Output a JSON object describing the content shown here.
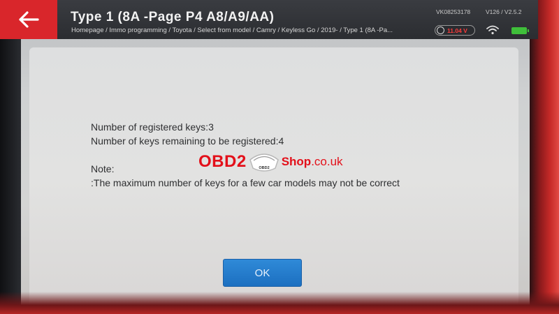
{
  "header": {
    "back_icon": "back-arrow-icon",
    "title": "Type 1 (8A -Page P4 A8/A9/AA)",
    "breadcrumb": "Homepage / Immo programming / Toyota / Select from  model / Camry / Keyless Go / 2019- / Type 1 (8A -Pa...",
    "serial": "VK08253178",
    "version": "V126 / V2.5.2",
    "voltage": "11.04 V",
    "accent_color": "#d9262b",
    "voltage_color": "#ff3b3b",
    "battery_color": "#3fbf3a"
  },
  "dialog": {
    "line1": "Number of registered keys:3",
    "line2": "Number of keys remaining to be registered:4",
    "note_label": "Note:",
    "note_text": ":The maximum number of keys for a few car models may not be correct",
    "ok_label": "OK",
    "ok_color": "#1c6fc0"
  },
  "watermark": {
    "brand": "OBD2",
    "logo_text": "OBD2",
    "shop": "Shop",
    "domain": ".co.uk",
    "color": "#e3101a"
  }
}
